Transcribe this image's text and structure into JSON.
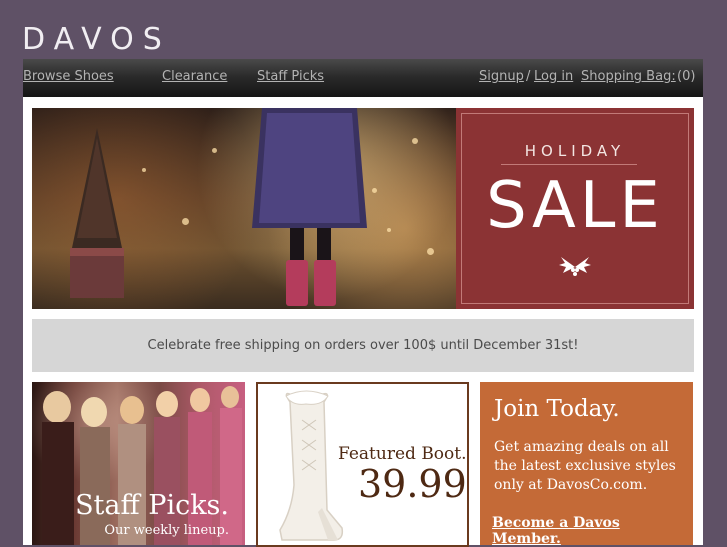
{
  "brand": {
    "logo": "DAVOS"
  },
  "nav": {
    "browse": "Browse Shoes",
    "clearance": "Clearance",
    "staff_picks": "Staff Picks",
    "signup": "Signup",
    "separator": "/",
    "login": "Log in",
    "bag": "Shopping Bag:",
    "bag_count": "(0)"
  },
  "hero": {
    "holiday": "HOLIDAY",
    "sale": "SALE",
    "icons": [
      "holly-icon"
    ]
  },
  "promo": {
    "text": "Celebrate free shipping on orders over 100$ until December 31st!"
  },
  "tiles": {
    "staff": {
      "title": "Staff Picks.",
      "subtitle": "Our weekly lineup."
    },
    "boot": {
      "label": "Featured Boot.",
      "price": "39.99"
    },
    "join": {
      "title": "Join Today.",
      "text": "Get amazing deals on all the latest exclusive styles only at DavosCo.com.",
      "link": "Become a Davos Member."
    }
  },
  "colors": {
    "background": "#5f5166",
    "sale_panel": "#8b3334",
    "join_panel": "#c46a37",
    "promo_bar": "#d6d6d6",
    "boot_border": "#6a3a1f"
  }
}
